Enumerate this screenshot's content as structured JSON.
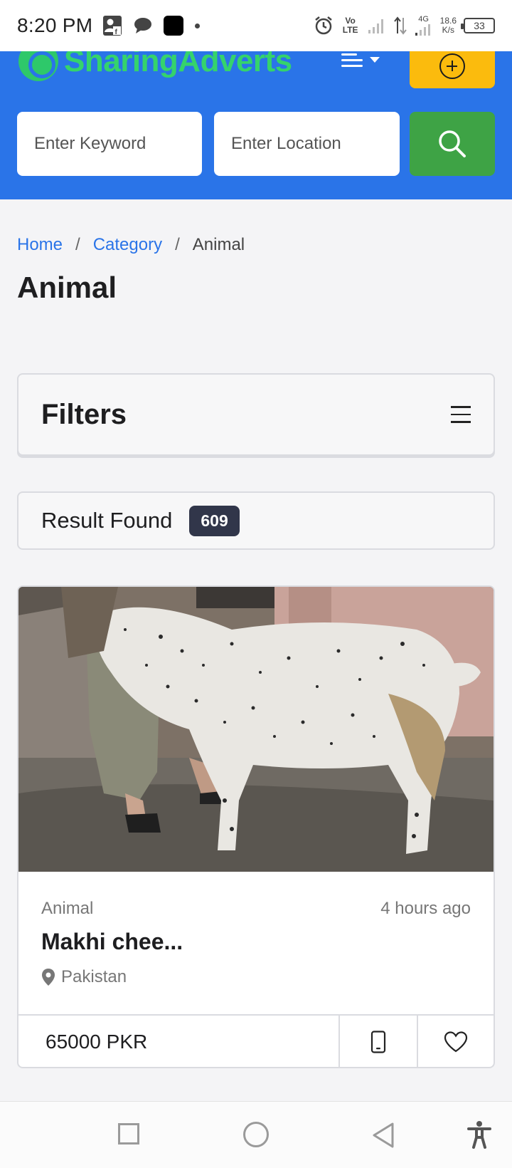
{
  "status_bar": {
    "time": "8:20 PM",
    "network_type": "Vo LTE",
    "signal_label": "4G",
    "speed_value": "18.6",
    "speed_unit": "K/s",
    "battery": "33"
  },
  "header": {
    "logo_text": "SharingAdverts",
    "keyword_placeholder": "Enter Keyword",
    "location_placeholder": "Enter Location",
    "brand_color": "#2a74e8",
    "add_button_color": "#fbbb0d",
    "search_button_color": "#3ea345"
  },
  "breadcrumb": {
    "home": "Home",
    "sep1": "/",
    "category": "Category",
    "sep2": "/",
    "current": "Animal"
  },
  "page_title": "Animal",
  "filters": {
    "title": "Filters"
  },
  "results": {
    "label": "Result Found",
    "count": "609"
  },
  "listing": {
    "category": "Animal",
    "time_ago": "4 hours ago",
    "title": "Makhi chee...",
    "location": "Pakistan",
    "price": "65000 PKR",
    "image_subject": "white spotted goat"
  },
  "icons": {
    "add": "plus-circle-icon",
    "search": "search-icon",
    "menu": "hamburger-icon",
    "location": "map-pin-icon",
    "phone": "mobile-phone-icon",
    "favorite": "heart-icon"
  }
}
